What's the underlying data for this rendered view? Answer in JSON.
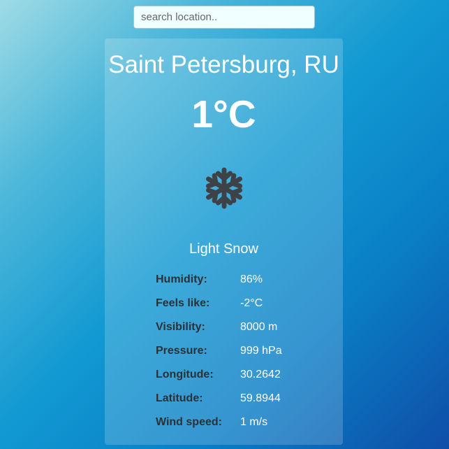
{
  "search": {
    "placeholder": "search location..",
    "value": ""
  },
  "weather": {
    "city": "Saint Petersburg, RU",
    "temperature": "1°C",
    "icon": "snowflake-icon",
    "condition": "Light Snow"
  },
  "stats": [
    {
      "label": "Humidity:",
      "value": "86%"
    },
    {
      "label": "Feels like:",
      "value": "-2°C"
    },
    {
      "label": "Visibility:",
      "value": "8000 m"
    },
    {
      "label": "Pressure:",
      "value": "999 hPa"
    },
    {
      "label": "Longitude:",
      "value": "30.2642"
    },
    {
      "label": "Latitude:",
      "value": "59.8944"
    },
    {
      "label": "Wind speed:",
      "value": "1 m/s"
    }
  ],
  "colors": {
    "label": "#2b3138",
    "value": "#ffffff",
    "icon": "#3e4247"
  }
}
